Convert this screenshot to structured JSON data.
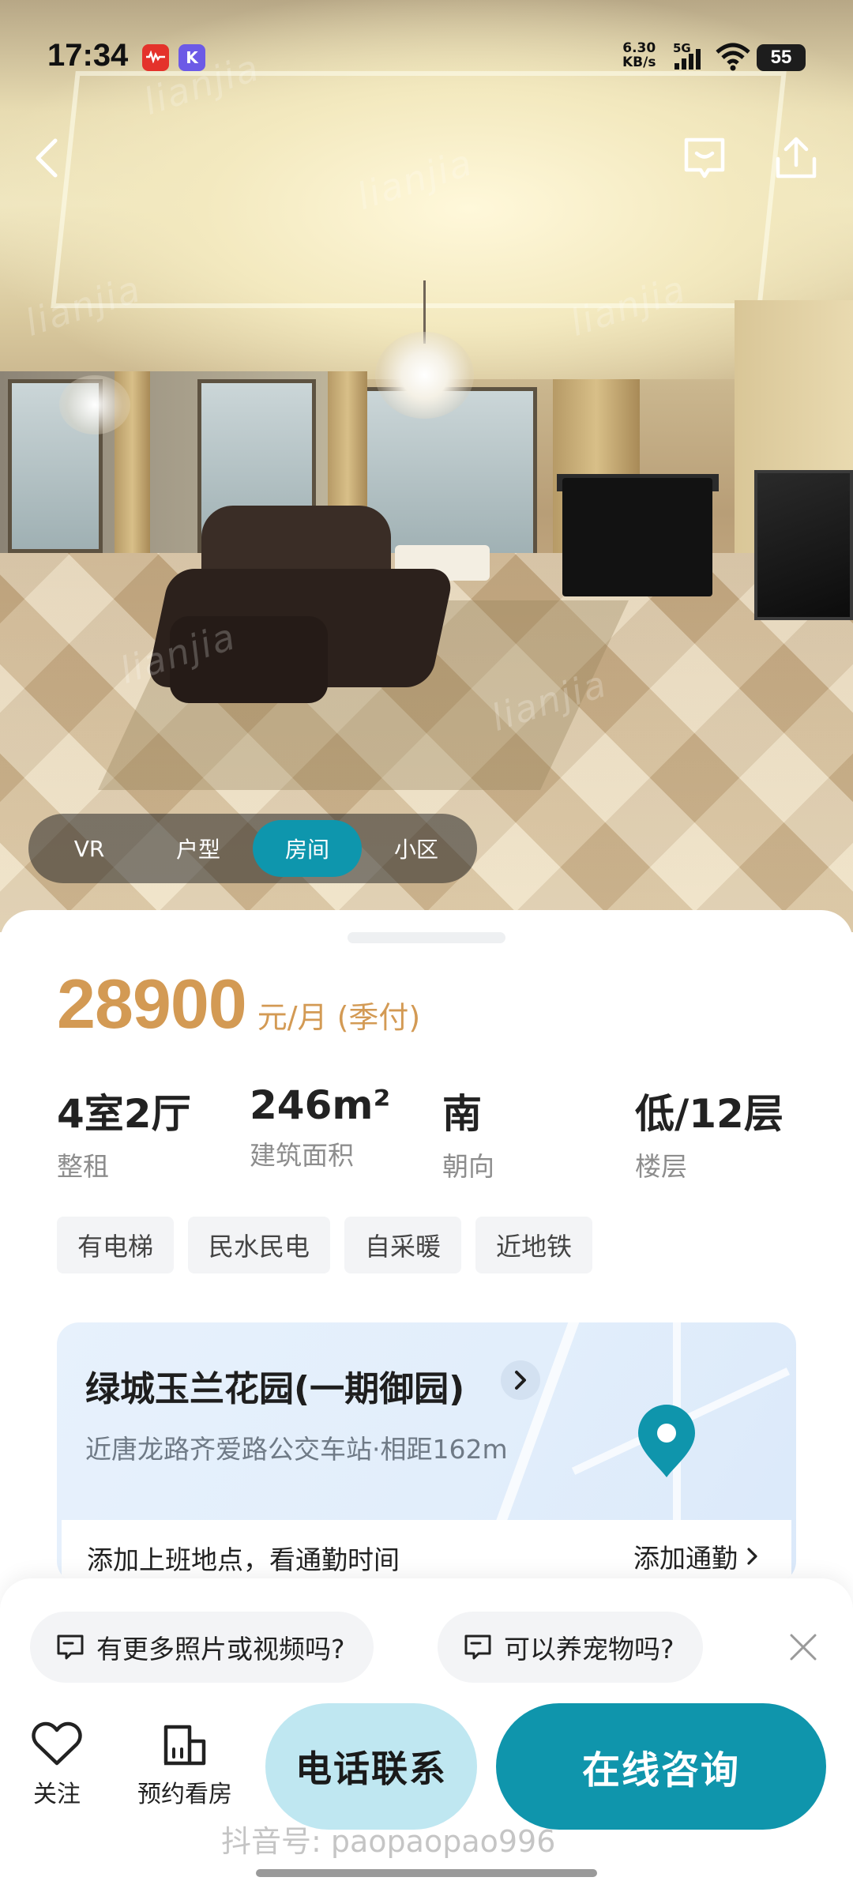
{
  "status_bar": {
    "time": "17:34",
    "net_speed_value": "6.30",
    "net_speed_unit": "KB/s",
    "network_type": "5G",
    "battery": "55"
  },
  "hero": {
    "watermark": "lianjia"
  },
  "gallery_tabs": [
    {
      "label": "VR",
      "active": false
    },
    {
      "label": "户型",
      "active": false
    },
    {
      "label": "房间",
      "active": true
    },
    {
      "label": "小区",
      "active": false
    }
  ],
  "listing": {
    "price": "28900",
    "price_unit": "元/月 (季付)",
    "facts": [
      {
        "value": "4室2厅",
        "label": "整租"
      },
      {
        "value": "246m²",
        "label": "建筑面积"
      },
      {
        "value": "南",
        "label": "朝向"
      },
      {
        "value": "低/12层",
        "label": "楼层"
      }
    ],
    "tags": [
      "有电梯",
      "民水民电",
      "自采暖",
      "近地铁"
    ]
  },
  "community": {
    "name": "绿城玉兰花园(一期御园)",
    "nearby": "近唐龙路齐爱路公交车站·相距162m",
    "commute_prompt": "添加上班地点，看通勤时间",
    "commute_action": "添加通勤"
  },
  "quick_questions": [
    "有更多照片或视频吗?",
    "可以养宠物吗?"
  ],
  "bottom_bar": {
    "follow_label": "关注",
    "viewing_label": "预约看房",
    "call_label": "电话联系",
    "chat_label": "在线咨询"
  },
  "overlay_watermark": "抖音号: paopaopao996",
  "colors": {
    "accent": "#0f95ac",
    "price": "#d39a54",
    "call_button": "#bfe7f1"
  }
}
